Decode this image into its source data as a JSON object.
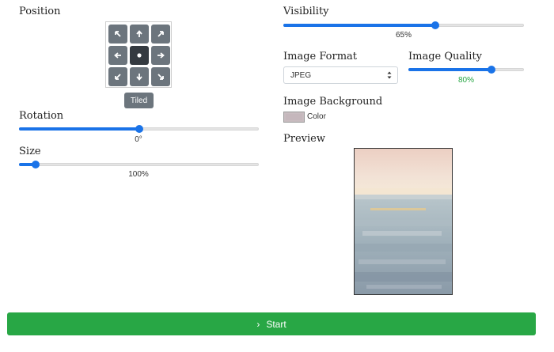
{
  "left": {
    "position_label": "Position",
    "tiled_label": "Tiled",
    "rotation_label": "Rotation",
    "rotation_value_text": "0°",
    "rotation_fraction": 0.5,
    "size_label": "Size",
    "size_value_text": "100%",
    "size_fraction": 0.07
  },
  "right": {
    "visibility_label": "Visibility",
    "visibility_value_text": "65%",
    "visibility_fraction": 0.63,
    "format_label": "Image Format",
    "format_selected": "JPEG",
    "quality_label": "Image Quality",
    "quality_value_text": "80%",
    "quality_fraction": 0.72,
    "background_label": "Image Background",
    "color_label": "Color",
    "preview_label": "Preview"
  },
  "start_label": "Start",
  "colors": {
    "accent": "#1a73e8",
    "start": "#28a745",
    "quality_text": "#28a745",
    "grid_button": "#6c757d",
    "grid_button_active": "#343a40"
  }
}
